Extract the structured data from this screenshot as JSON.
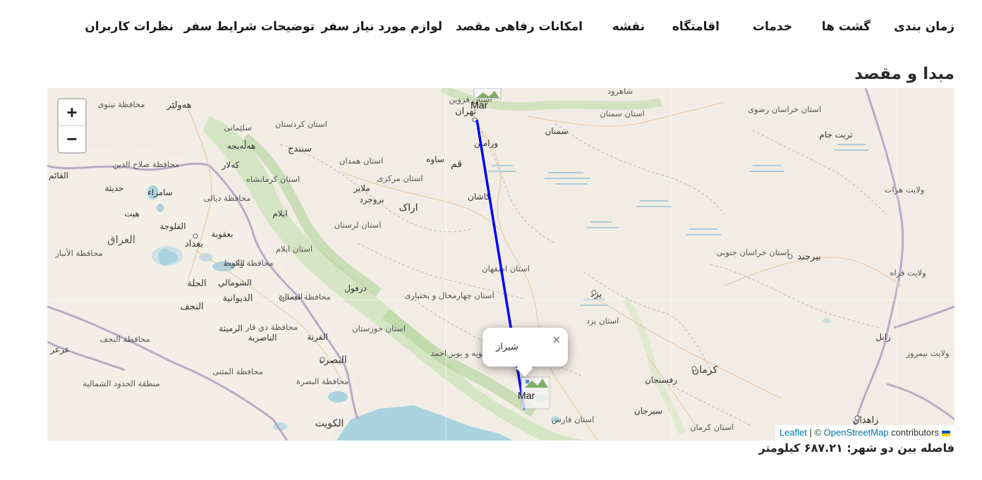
{
  "nav": {
    "items": [
      "زمان بندی",
      "گشت ها",
      "خدمات",
      "اقامتگاه",
      "نقشه",
      "امکانات رفاهی مقصد",
      "لوازم مورد نیاز سفر",
      "توضیحات شرایط سفر",
      "نظرات کاربران"
    ]
  },
  "section": {
    "title": "مبدا و مقصد"
  },
  "map": {
    "zoom_in": "+",
    "zoom_out": "−",
    "origin_marker_label": "Mar",
    "destination_marker_label": "Mar",
    "popup_text": "شیراز",
    "popup_close": "×",
    "route_color": "#0000ff",
    "attribution": {
      "leaflet": "Leaflet",
      "separator": " | © ",
      "osm": "OpenStreetMap",
      "contributors": " contributors"
    },
    "places": {
      "tehran": "تهران",
      "qazvin": "استان قزوین",
      "semnan": "سمنان",
      "semnan_prov": "استان سمنان",
      "shahrud": "شاهرود",
      "varamin": "ورامین",
      "qom": "قم",
      "saveh": "ساوه",
      "arak": "اراک",
      "markazi": "استان مرکزی",
      "hamadan": "استان همدان",
      "kermanshah": "استان کرمانشاه",
      "kurdistan": "استان کردستان",
      "sanandaj": "سنندج",
      "kashan": "کاشان",
      "isfahan_prov": "استان اصفهان",
      "lorestan": "استان لرستان",
      "borujerd": "بروجرد",
      "malayer": "ملایر",
      "ilam_prov": "استان ایلام",
      "ilam": "ایلام",
      "dezful": "دزفول",
      "chaharmahal": "استان چهارمحال و بختیاری",
      "khuzestan": "استان خوزستان",
      "kohgiluyeh": "استان کهگیلویه و بویر احمد",
      "fars": "استان فارس",
      "yazd": "یزد",
      "yazd_prov": "استان یزد",
      "kerman": "کرمان",
      "kerman_prov": "استان کرمان",
      "rafsanjan": "رفسنجان",
      "sirjan": "سیرجان",
      "birjand": "بیرجند",
      "south_khorasan": "استان خراسان جنوبی",
      "razavi": "استان خراسان رضوی",
      "torbat": "تربت جام",
      "zabol": "زابل",
      "zahedan": "زاهدان",
      "herat": "ولایت هرات",
      "farah": "ولایت فراه",
      "nimruz": "ولایت نیمروز",
      "baghdad": "بغداد",
      "iraq": "العراق",
      "basra": "البصرة",
      "kuwait": "الكويت",
      "najaf": "النجف",
      "hilla": "الحلة",
      "diwaniyah": "الديوانية",
      "baqubah": "بعقوبة",
      "fallujah": "الفلوجة",
      "samarra": "سامراء",
      "hit": "هيت",
      "haditha": "حديثة",
      "erbil": "هەولێر",
      "sulaymaniyah": "سلێمانی",
      "halabja": "هەڵەبجە",
      "kalar": "کەلار",
      "kut": "الكوت",
      "amarah": "العمارة",
      "nasiriyah": "الناصرية",
      "qurna": "القرنة",
      "qaim": "القائم",
      "arar": "عرعر",
      "shumali": "الشومالي",
      "muthanna": "محافظة المثنى",
      "anbar": "محافظة الأنبار",
      "najaf_gov": "محافظة النجف",
      "basra_gov": "محافظة البصرة",
      "maysan": "محافظة ميسان",
      "wasit": "محافظة واسط",
      "diyala": "محافظة ديالى",
      "salahuddin": "محافظة صلاح الدين",
      "ninawa": "محافظة نينوى",
      "border_region": "منطقة الحدود الشمالية",
      "rumaitha": "الرميثة",
      "qadisiyah": "محافظة ذي قار"
    }
  },
  "distance": {
    "label": "فاصله بین دو شهر:",
    "value": "۶۸۷.۲۱",
    "unit": "کیلومتر"
  }
}
